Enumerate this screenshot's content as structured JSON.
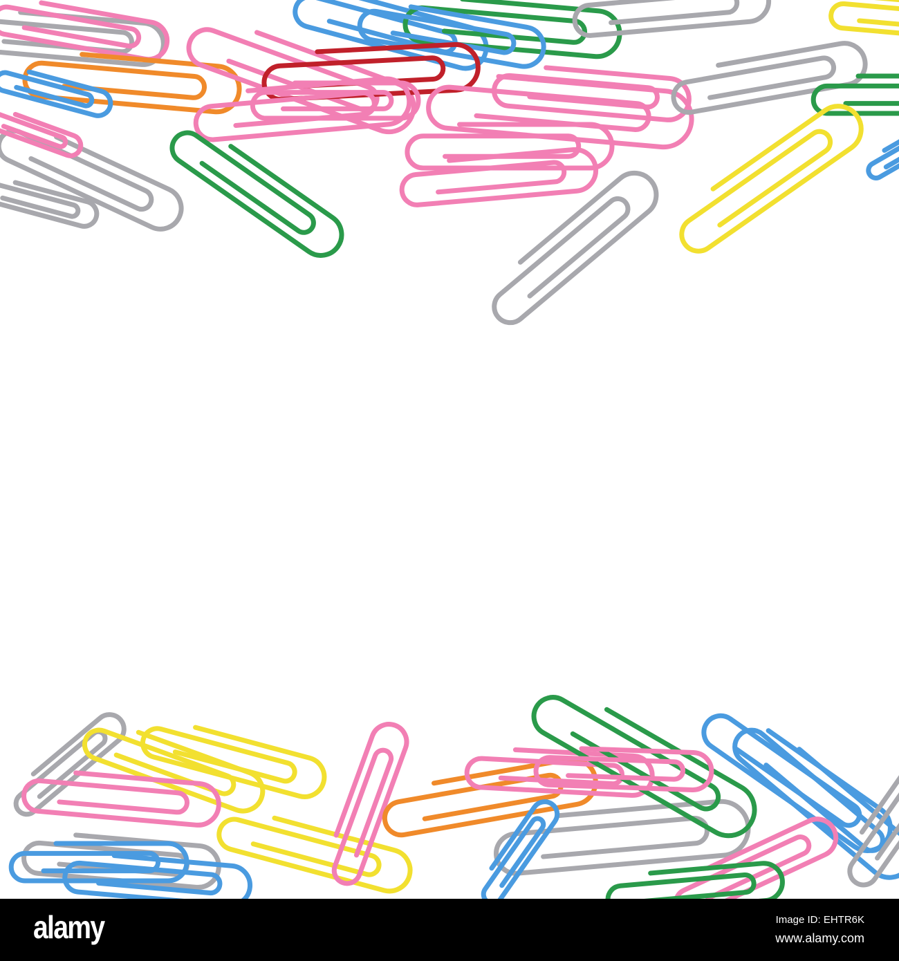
{
  "watermark": {
    "logo": "alamy",
    "image_id": "Image ID: EHTR6K",
    "url": "www.alamy.com"
  },
  "colors": {
    "pink": "#f27fb4",
    "green": "#2a9a4a",
    "blue": "#4a9be0",
    "yellow": "#f2e030",
    "orange": "#f08a2a",
    "red": "#c0202a",
    "silver": "#a8a8ad"
  }
}
